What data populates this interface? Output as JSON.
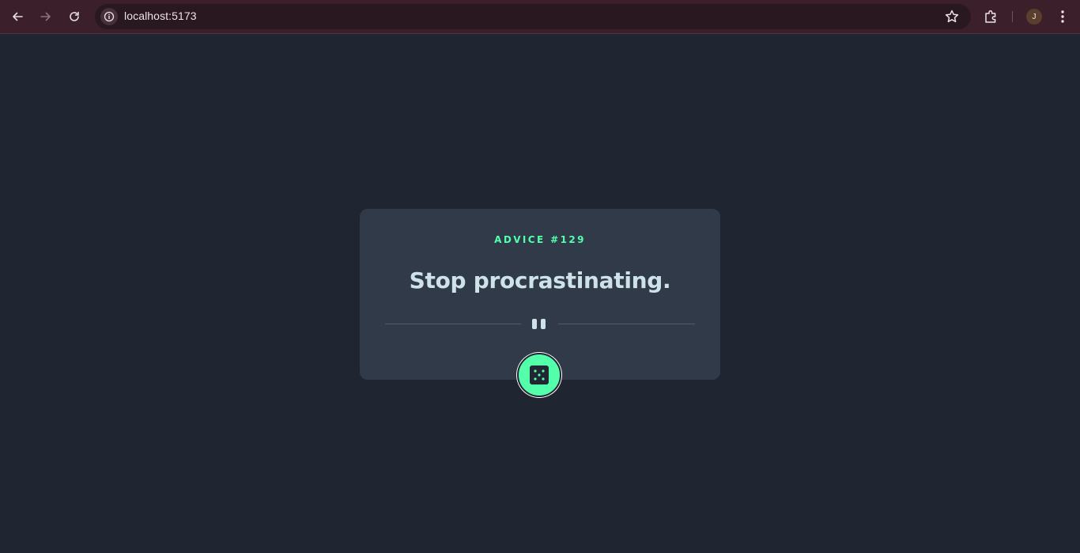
{
  "browser": {
    "url": "localhost:5173",
    "profile_initial": "J",
    "icons": {
      "back": "arrow-left-icon",
      "forward": "arrow-right-icon",
      "reload": "reload-icon",
      "site_info": "info-icon",
      "bookmark": "star-icon",
      "extensions": "puzzle-icon",
      "menu": "kebab-menu-icon"
    }
  },
  "advice": {
    "id_label": "ADVICE #129",
    "text": "Stop procrastinating."
  },
  "divider": {
    "icon": "pause-quote-icon"
  },
  "generate_button": {
    "icon": "dice-icon"
  },
  "colors": {
    "background": "#1f2632",
    "card": "#313a49",
    "accent": "#53ffaa",
    "text": "#cee3e9",
    "browser_bar": "#3b1f2a"
  }
}
